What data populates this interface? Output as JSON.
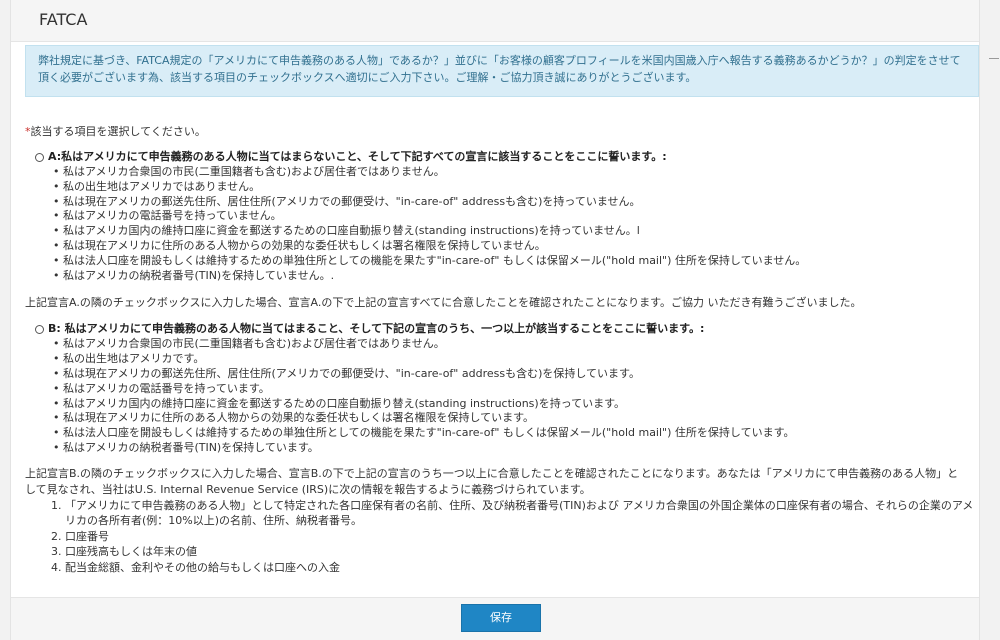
{
  "panel": {
    "title": "FATCA"
  },
  "notice": {
    "text": "弊社規定に基づき、FATCA規定の「アメリカにて申告義務のある人物」であるか？」並びに「お客様の顧客プロフィールを米国内国歳入庁へ報告する義務あるかどうか？」の判定をさせて頂く必要がございます為、該当する項目のチェックボックスへ適切にご入力下さい。ご理解・ご協力頂き誠にありがとうございます。"
  },
  "form": {
    "required_mark": "*",
    "prompt": "該当する項目を選択してください。",
    "option_a": {
      "label": "A:私はアメリカにて申告義務のある人物に当てはまらないこと、そして下記すべての宣言に該当することをここに誓います。:",
      "items": [
        "私はアメリカ合衆国の市民(二重国籍者も含む)および居住者ではありません。",
        "私の出生地はアメリカではありません。",
        "私は現在アメリカの郵送先住所、居住住所(アメリカでの郵便受け、\"in-care-of\" addressも含む)を持っていません。",
        "私はアメリカの電話番号を持っていません。",
        "私はアメリカ国内の維持口座に資金を郵送するための口座自動振り替え(standing instructions)を持っていません。l",
        "私は現在アメリカに住所のある人物からの効果的な委任状もしくは署名権限を保持していません。",
        "私は法人口座を開設もしくは維持するための単独住所としての機能を果たす\"in-care-of\" もしくは保留メール(\"hold mail\") 住所を保持していません。",
        "私はアメリカの納税者番号(TIN)を保持していません。."
      ],
      "confirmation": "上記宣言A.の隣のチェックボックスに入力した場合、宣言A.の下で上記の宣言すべてに合意したことを確認されたことになります。ご協力 いただき有難うございました。"
    },
    "option_b": {
      "label": "B: 私はアメリカにて申告義務のある人物に当てはまること、そして下記の宣言のうち、一つ以上が該当することをここに誓います。:",
      "items": [
        "私はアメリカ合衆国の市民(二重国籍者も含む)および居住者ではありません。",
        "私の出生地はアメリカです。",
        "私は現在アメリカの郵送先住所、居住住所(アメリカでの郵便受け、\"in-care-of\" addressも含む)を保持しています。",
        "私はアメリカの電話番号を持っています。",
        "私はアメリカ国内の維持口座に資金を郵送するための口座自動振り替え(standing instructions)を持っています。",
        "私は現在アメリカに住所のある人物からの効果的な委任状もしくは署名権限を保持しています。",
        "私は法人口座を開設もしくは維持するための単独住所としての機能を果たす\"in-care-of\" もしくは保留メール(\"hold mail\") 住所を保持しています。",
        "私はアメリカの納税者番号(TIN)を保持しています。"
      ],
      "confirmation": "上記宣言B.の隣のチェックボックスに入力した場合、宣言B.の下で上記の宣言のうち一つ以上に合意したことを確認されたことになります。あなたは「アメリカにて申告義務のある人物」として見なされ、当社はU.S. Internal Revenue Service (IRS)に次の情報を報告するように義務づけられています。",
      "info_items": [
        {
          "num": "1.",
          "text": "「アメリカにて申告義務のある人物」として特定された各口座保有者の名前、住所、及び納税者番号(TIN)および アメリカ合衆国の外国企業体の口座保有者の場合、それらの企業のアメリカの各所有者(例：10%以上)の名前、住所、納税者番号。"
        },
        {
          "num": "2.",
          "text": "口座番号"
        },
        {
          "num": "3.",
          "text": "口座残高もしくは年末の値"
        },
        {
          "num": "4.",
          "text": "配当金総額、金利やその他の給与もしくは口座への入金"
        }
      ]
    }
  },
  "footer": {
    "save_label": "保存"
  },
  "colors": {
    "accent": "#1f86c5",
    "notice_bg": "#d9edf7",
    "notice_text": "#31708f"
  }
}
